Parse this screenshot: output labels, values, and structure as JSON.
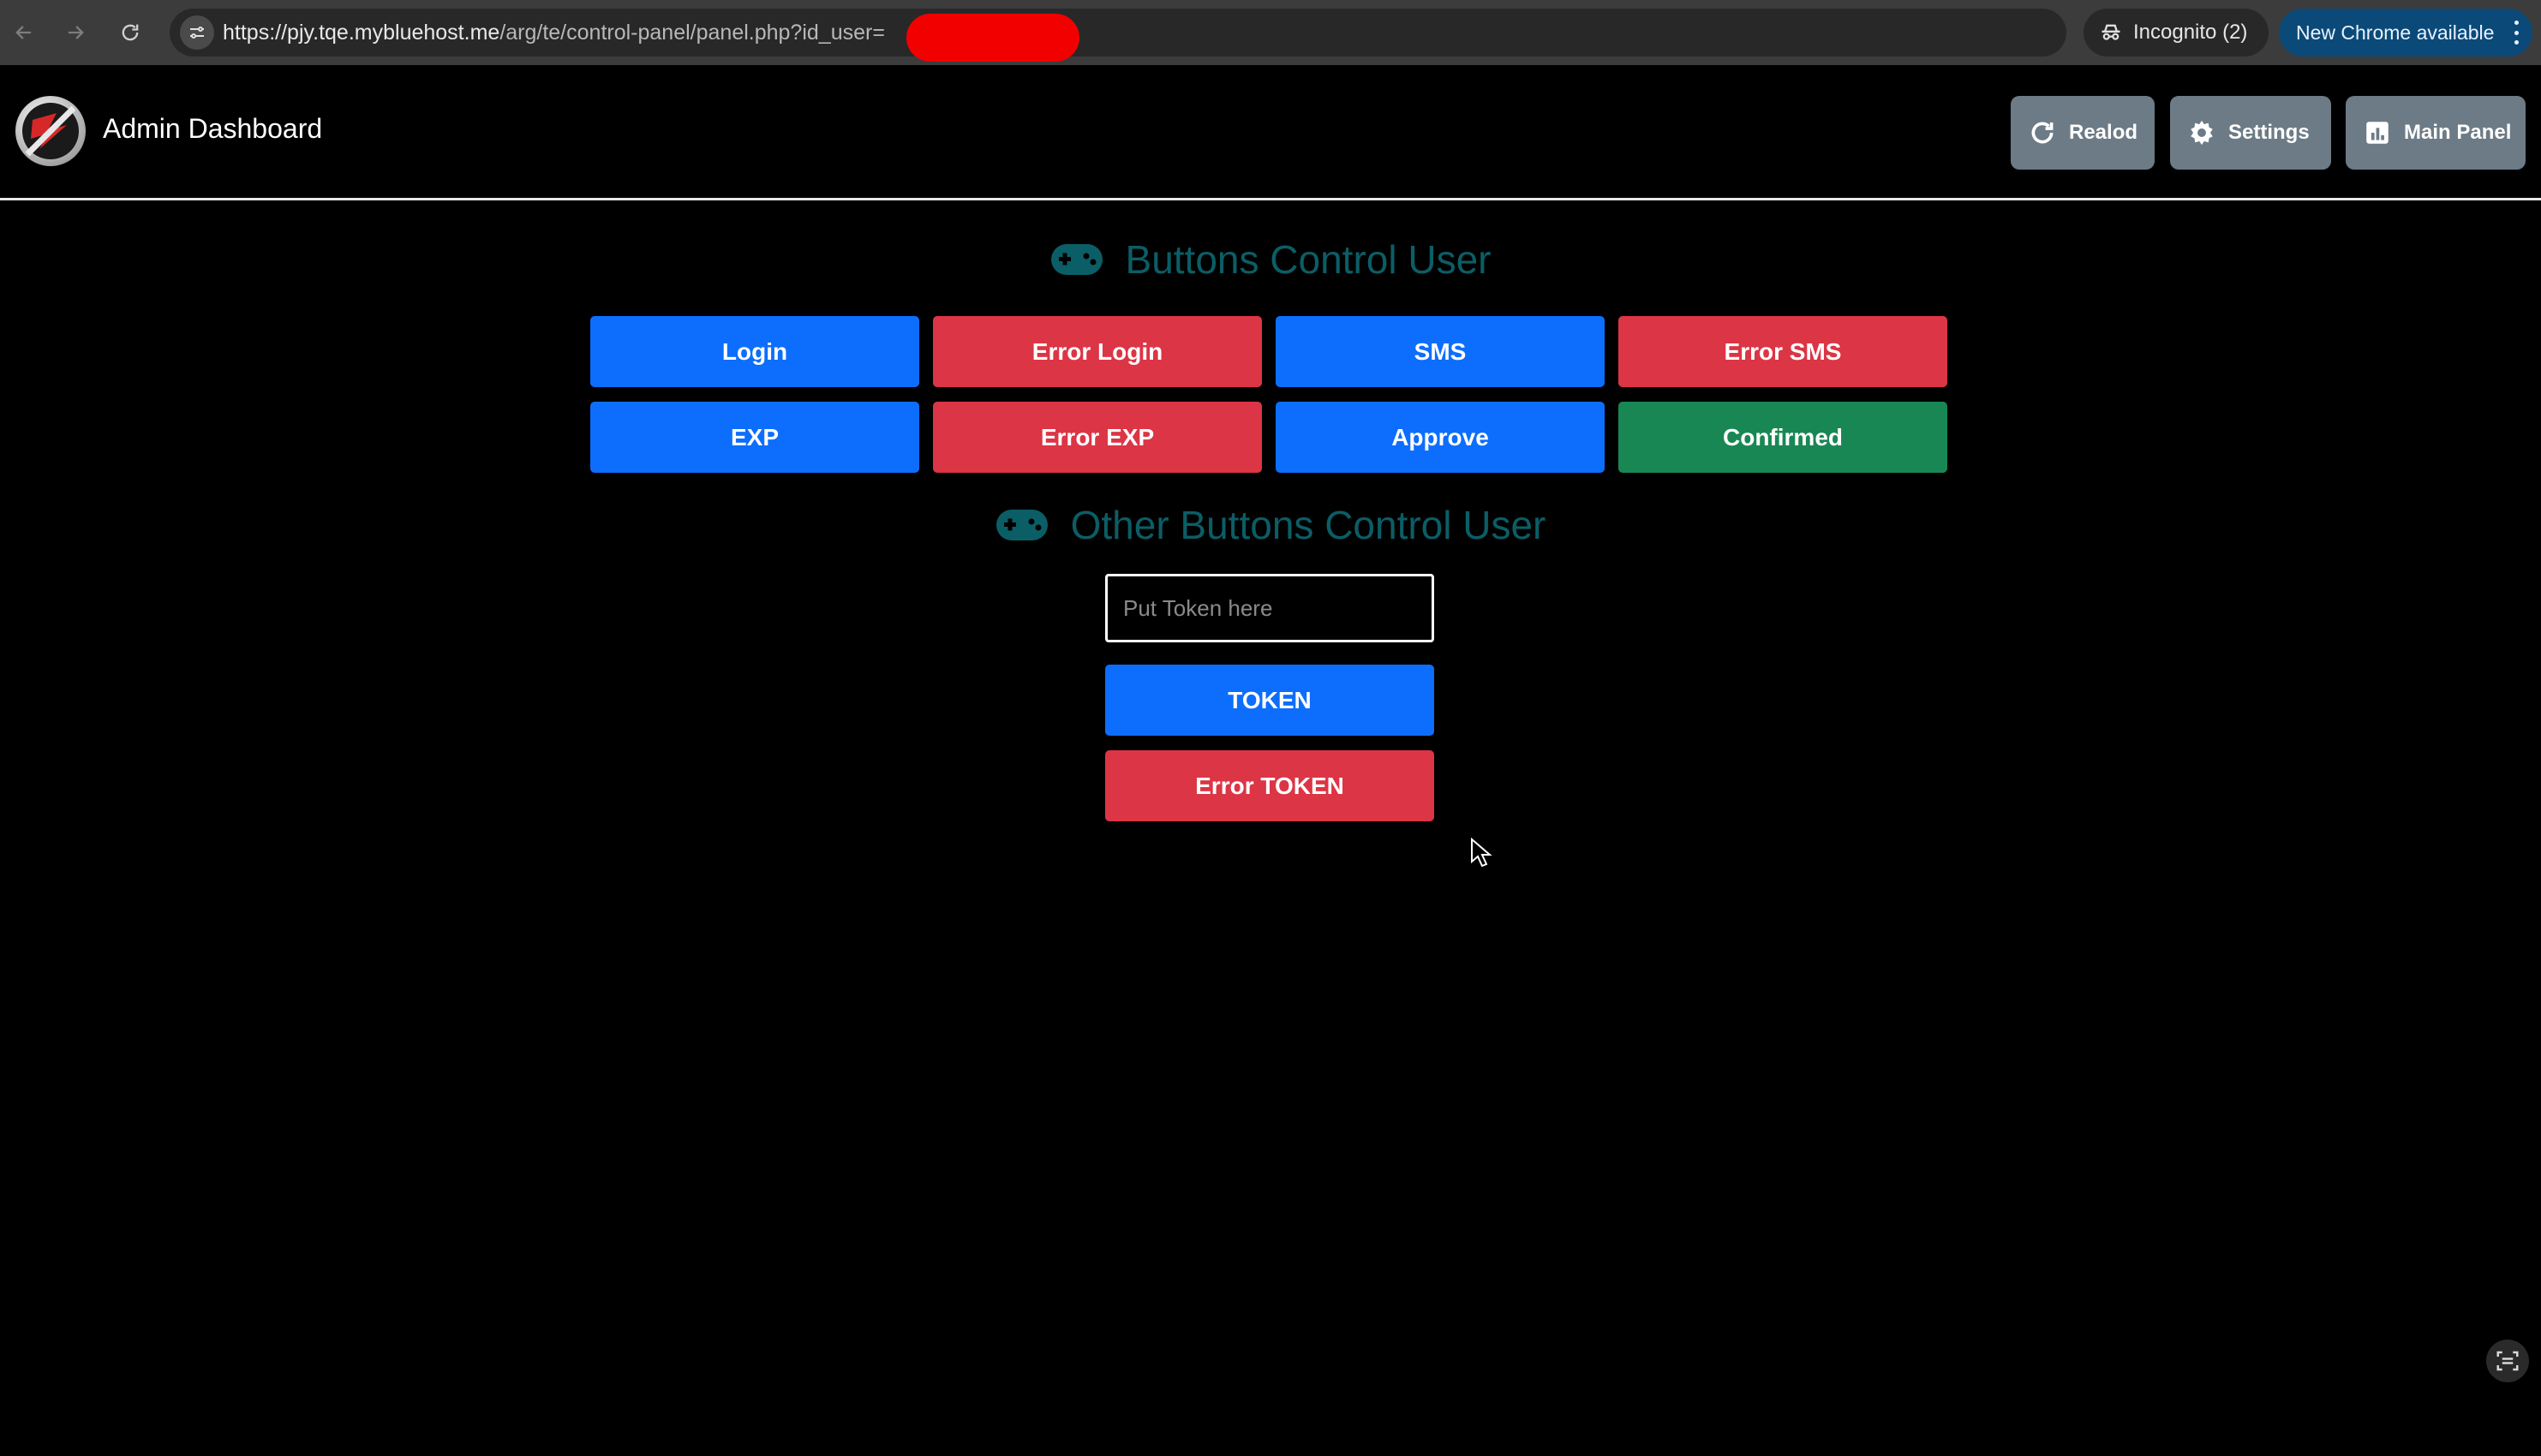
{
  "browser": {
    "url_main": "https://pjy.tqe.mybluehost.me",
    "url_path": "/arg/te/control-panel/panel.php?id_user=",
    "incognito_label": "Incognito (2)",
    "update_label": "New Chrome available"
  },
  "header": {
    "title": "Admin Dashboard",
    "reload_label": "Realod",
    "settings_label": "Settings",
    "main_panel_label": "Main Panel"
  },
  "controls": {
    "title": "Buttons Control User",
    "buttons": [
      {
        "label": "Login",
        "color": "#0d6efd"
      },
      {
        "label": "Error Login",
        "color": "#dc3545"
      },
      {
        "label": "SMS",
        "color": "#0d6efd"
      },
      {
        "label": "Error SMS",
        "color": "#dc3545"
      },
      {
        "label": "EXP",
        "color": "#0d6efd"
      },
      {
        "label": "Error EXP",
        "color": "#dc3545"
      },
      {
        "label": "Approve",
        "color": "#0d6efd"
      },
      {
        "label": "Confirmed",
        "color": "#198754"
      }
    ]
  },
  "other_controls": {
    "title": "Other Buttons Control User",
    "token_placeholder": "Put Token here",
    "token_value": "",
    "token_button": "TOKEN",
    "error_token_button": "Error TOKEN"
  },
  "colors": {
    "primary": "#0d6efd",
    "danger": "#dc3545",
    "success": "#198754",
    "secondary": "#6c7b86",
    "heading": "#0b5e66"
  }
}
